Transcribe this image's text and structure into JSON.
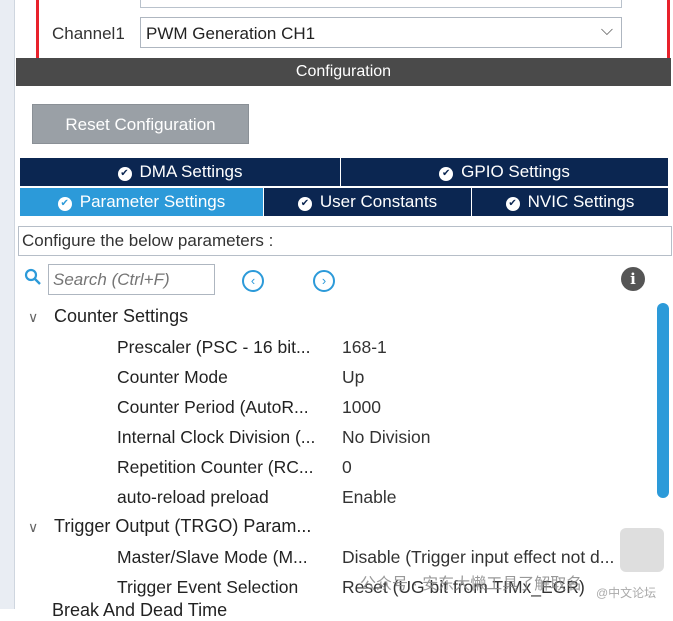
{
  "channel": {
    "label": "Channel1",
    "value": "PWM Generation CH1"
  },
  "config_header": "Configuration",
  "reset_button": "Reset Configuration",
  "tabs_row1": [
    "DMA Settings",
    "GPIO Settings"
  ],
  "tabs_row2": [
    "Parameter Settings",
    "User Constants",
    "NVIC Settings"
  ],
  "description": "Configure the below parameters :",
  "search": {
    "placeholder": "Search (Ctrl+F)"
  },
  "groups": [
    {
      "name": "Counter Settings",
      "params": [
        {
          "name": "Prescaler (PSC - 16 bit...",
          "value": "168-1"
        },
        {
          "name": "Counter Mode",
          "value": "Up"
        },
        {
          "name": "Counter Period (AutoR...",
          "value": "1000"
        },
        {
          "name": "Internal Clock Division (...",
          "value": "No Division"
        },
        {
          "name": "Repetition Counter (RC...",
          "value": "0"
        },
        {
          "name": "auto-reload preload",
          "value": "Enable"
        }
      ]
    },
    {
      "name": "Trigger Output (TRGO) Param...",
      "params": [
        {
          "name": "Master/Slave Mode (M...",
          "value": "Disable (Trigger input effect not d..."
        },
        {
          "name": "Trigger Event Selection",
          "value": "Reset (UG bit from TIMx_EGR)"
        }
      ]
    }
  ],
  "next_group_partial": "Break And Dead Time",
  "watermark": "公众号 · 安东大懒工具了解取名",
  "watermark_small": "@中文论坛",
  "colors": {
    "tab_dark": "#0b2651",
    "tab_active": "#2c9ad9",
    "highlight": "#e8212b"
  }
}
